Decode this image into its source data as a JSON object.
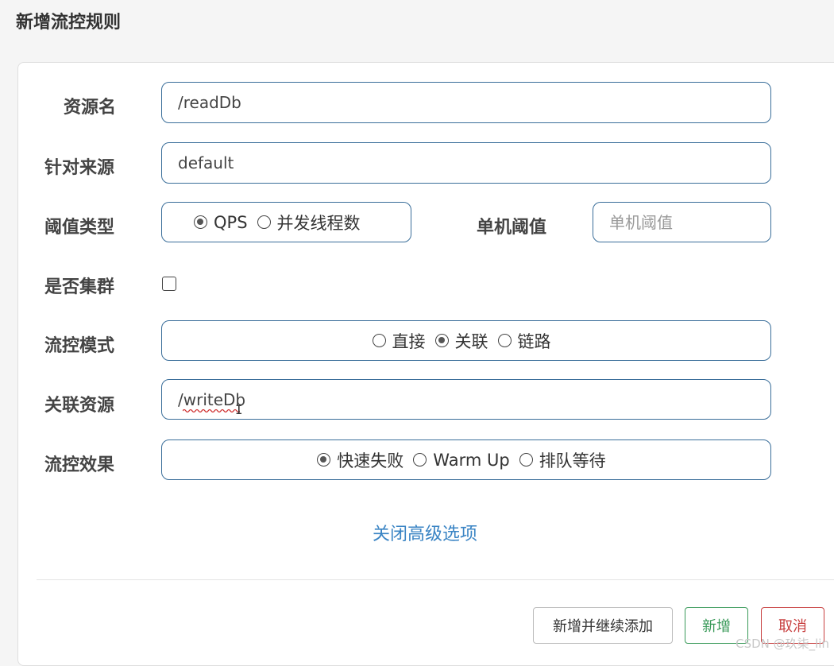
{
  "dialog": {
    "title": "新增流控规则"
  },
  "form": {
    "resource_name": {
      "label": "资源名",
      "value": "/readDb"
    },
    "limit_app": {
      "label": "针对来源",
      "value": "default"
    },
    "grade": {
      "label": "阈值类型",
      "options": [
        "QPS",
        "并发线程数"
      ],
      "selected": "QPS"
    },
    "count": {
      "label": "单机阈值",
      "placeholder": "单机阈值"
    },
    "cluster_mode": {
      "label": "是否集群",
      "checked": false
    },
    "strategy": {
      "label": "流控模式",
      "options": [
        "直接",
        "关联",
        "链路"
      ],
      "selected": "关联"
    },
    "ref_resource": {
      "label": "关联资源",
      "value": "/writeDb"
    },
    "control_behavior": {
      "label": "流控效果",
      "options": [
        "快速失败",
        "Warm Up",
        "排队等待"
      ],
      "selected": "快速失败"
    },
    "advanced_toggle": "关闭高级选项"
  },
  "footer": {
    "add_continue": "新增并继续添加",
    "add": "新增",
    "cancel": "取消"
  },
  "watermark": "CSDN @玖柒_lin",
  "colors": {
    "field_border": "#3a6e9a",
    "link": "#3a84c4",
    "add_green": "#3a9a5a",
    "cancel_red": "#c84040"
  }
}
